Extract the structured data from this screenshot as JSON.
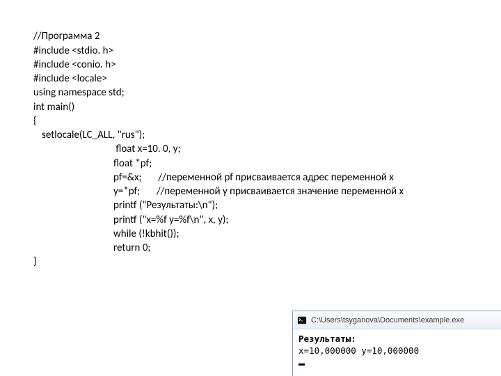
{
  "code": {
    "l1": "//Программа 2",
    "l2": "#include <stdio. h>",
    "l3": "#include <conio. h>",
    "l4": "#include <locale>",
    "l5": "using namespace std;",
    "l6": "int main()",
    "l7": "{",
    "l8": "setlocale(LC_ALL, \"rus\");",
    "l9": " float x=10. 0, y;",
    "l10": "float *pf;",
    "l11": "pf=&x;       //переменной pf присваивается адрес переменной х",
    "l12": "y=*pf;       //переменной у присваивается значение переменной х",
    "l13": "printf (\"Результаты:\\n\");",
    "l14": "printf (\"x=%f y=%f\\n\", x, y);",
    "l15": "while (!kbhit());",
    "l16": "return 0;",
    "l17": "}"
  },
  "console": {
    "title": "C:\\Users\\tsyganova\\Documents\\example.exe",
    "line1": "Результаты:",
    "line2": "x=10,000000 y=10,000000"
  }
}
